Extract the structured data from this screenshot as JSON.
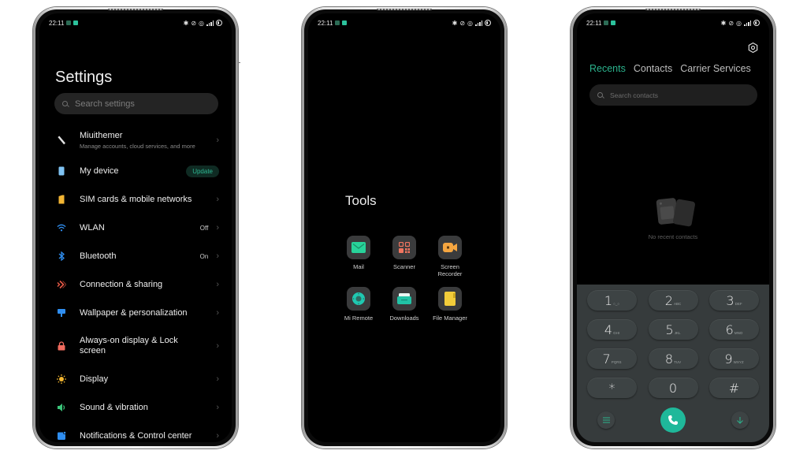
{
  "statusbar": {
    "time": "22:11",
    "right_icons": [
      "bluetooth-icon",
      "vibrate-off-icon",
      "hotspot-icon",
      "signal-icon",
      "battery-icon"
    ]
  },
  "settings": {
    "title": "Settings",
    "search_placeholder": "Search settings",
    "items": [
      {
        "label": "Miuithemer",
        "sub": "Manage accounts, cloud services, and more",
        "icon": "pen-icon",
        "color": "#e0e0e0"
      },
      {
        "label": "My device",
        "badge": "Update",
        "icon": "phone-icon",
        "color": "#7fc3f3"
      },
      {
        "label": "SIM cards & mobile networks",
        "icon": "sim-icon",
        "color": "#f2b533"
      },
      {
        "label": "WLAN",
        "value": "Off",
        "icon": "wifi-icon",
        "color": "#2f8ef0"
      },
      {
        "label": "Bluetooth",
        "value": "On",
        "icon": "bluetooth-icon",
        "color": "#2f8ef0"
      },
      {
        "label": "Connection & sharing",
        "icon": "connection-icon",
        "color": "#ea5a47"
      },
      {
        "label": "Wallpaper & personalization",
        "icon": "brush-icon",
        "color": "#2f8ef0"
      },
      {
        "label": "Always-on display & Lock screen",
        "icon": "lock-icon",
        "color": "#f06b5e"
      },
      {
        "label": "Display",
        "icon": "sun-icon",
        "color": "#f5b730"
      },
      {
        "label": "Sound & vibration",
        "icon": "speaker-icon",
        "color": "#3bc57a"
      },
      {
        "label": "Notifications & Control center",
        "icon": "notification-icon",
        "color": "#2f8ef0"
      }
    ],
    "update_color": "#2eb893"
  },
  "tools": {
    "title": "Tools",
    "apps": [
      {
        "label": "Mail",
        "icon": "mail-icon",
        "color": "#28d39a"
      },
      {
        "label": "Scanner",
        "icon": "scanner-icon",
        "color": "#f07560"
      },
      {
        "label": "Screen Recorder",
        "icon": "video-camera-icon",
        "color": "#f5a640"
      },
      {
        "label": "Mi Remote",
        "icon": "remote-icon",
        "color": "#1fc8b0"
      },
      {
        "label": "Downloads",
        "icon": "download-tray-icon",
        "color": "#21c3a6"
      },
      {
        "label": "File Manager",
        "icon": "folder-icon",
        "color": "#f2cc3a"
      }
    ]
  },
  "dialer": {
    "tabs": [
      {
        "label": "Recents",
        "active": true
      },
      {
        "label": "Contacts",
        "active": false
      },
      {
        "label": "Carrier Services",
        "active": false
      }
    ],
    "search_placeholder": "Search contacts",
    "empty_text": "No recent contacts",
    "keys": [
      {
        "digit": "1",
        "letters": "○_○"
      },
      {
        "digit": "2",
        "letters": "ABC"
      },
      {
        "digit": "3",
        "letters": "DEF"
      },
      {
        "digit": "4",
        "letters": "GHI"
      },
      {
        "digit": "5",
        "letters": "JKL"
      },
      {
        "digit": "6",
        "letters": "MNO"
      },
      {
        "digit": "7",
        "letters": "PQRS"
      },
      {
        "digit": "8",
        "letters": "TUV"
      },
      {
        "digit": "9",
        "letters": "WXYZ"
      },
      {
        "digit": "*",
        "letters": ""
      },
      {
        "digit": "0",
        "letters": ""
      },
      {
        "digit": "#",
        "letters": ""
      }
    ],
    "accent": "#2bb38d",
    "call_color": "#1fb89a"
  }
}
